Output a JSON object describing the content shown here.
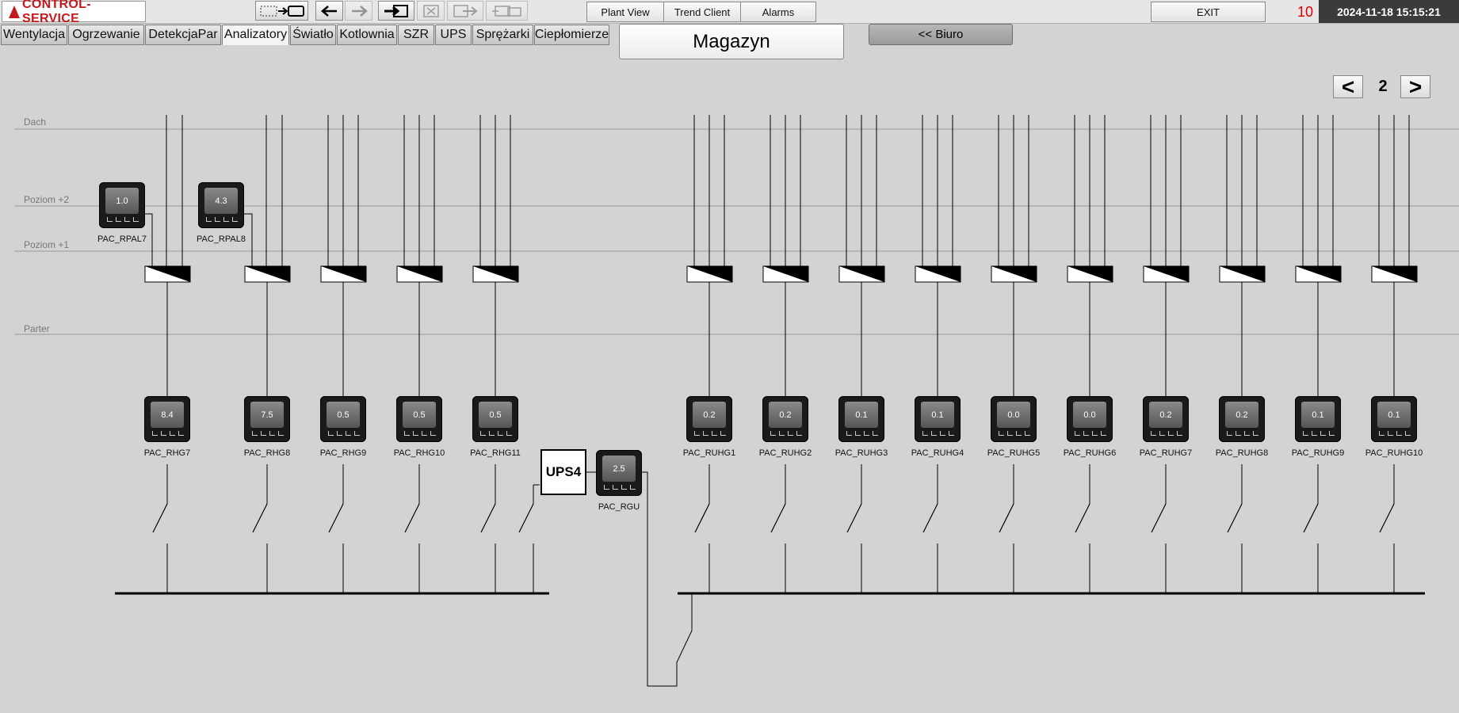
{
  "app": {
    "logo_text": "CONTROL-SERVICE",
    "buttons": {
      "plant_view": "Plant View",
      "trend_client": "Trend Client",
      "alarms": "Alarms",
      "exit": "EXIT"
    },
    "alarm_count": "10",
    "datetime": "2024-11-18  15:15:21"
  },
  "tabs": [
    "Wentylacja",
    "Ogrzewanie",
    "DetekcjaPar",
    "Analizatory",
    "Światło",
    "Kotlownia",
    "SZR",
    "UPS",
    "Sprężarki",
    "Ciepłomierze"
  ],
  "active_tab": "Analizatory",
  "view": {
    "title": "Magazyn",
    "back_button": "<< Biuro"
  },
  "pager": {
    "prev": "<",
    "page": "2",
    "next": ">"
  },
  "levels": {
    "roof": "Dach",
    "plus2": "Poziom +2",
    "plus1": "Poziom +1",
    "ground": "Parter"
  },
  "ups_label": "UPS4",
  "meters_upper": [
    {
      "id": "PAC_RPAL7",
      "value": "1.0"
    },
    {
      "id": "PAC_RPAL8",
      "value": "4.3"
    }
  ],
  "meters_lower": [
    {
      "id": "PAC_RHG7",
      "value": "8.4"
    },
    {
      "id": "PAC_RHG8",
      "value": "7.5"
    },
    {
      "id": "PAC_RHG9",
      "value": "0.5"
    },
    {
      "id": "PAC_RHG10",
      "value": "0.5"
    },
    {
      "id": "PAC_RHG11",
      "value": "0.5"
    },
    {
      "id": "PAC_RUHG1",
      "value": "0.2"
    },
    {
      "id": "PAC_RUHG2",
      "value": "0.2"
    },
    {
      "id": "PAC_RUHG3",
      "value": "0.1"
    },
    {
      "id": "PAC_RUHG4",
      "value": "0.1"
    },
    {
      "id": "PAC_RUHG5",
      "value": "0.0"
    },
    {
      "id": "PAC_RUHG6",
      "value": "0.0"
    },
    {
      "id": "PAC_RUHG7",
      "value": "0.2"
    },
    {
      "id": "PAC_RUHG8",
      "value": "0.2"
    },
    {
      "id": "PAC_RUHG9",
      "value": "0.1"
    },
    {
      "id": "PAC_RUHG10",
      "value": "0.1"
    }
  ],
  "meter_ups": {
    "id": "PAC_RGU",
    "value": "2.5"
  }
}
